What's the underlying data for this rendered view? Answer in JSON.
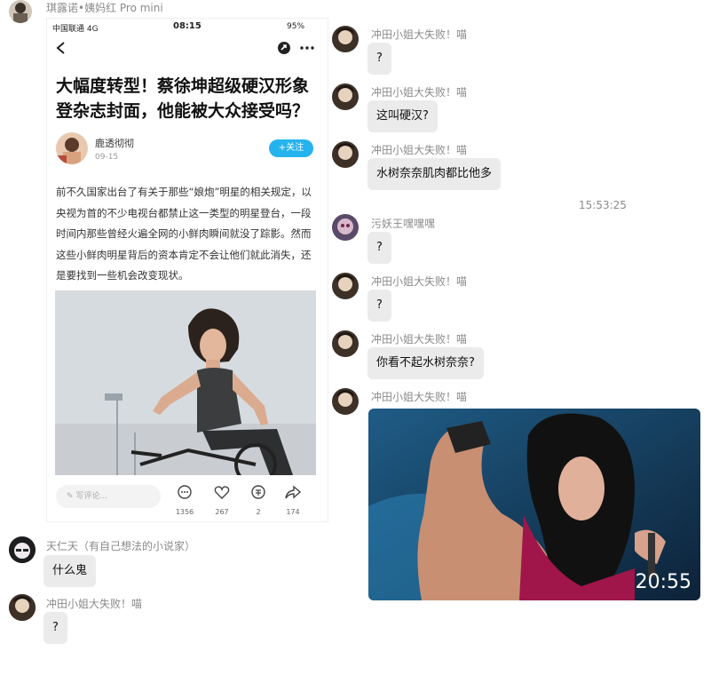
{
  "header": {
    "sender": "琪露诺•姨妈红 Pro mini"
  },
  "phone": {
    "carrier": "中国联通 4G",
    "time": "08:15",
    "battery": "95%",
    "headline": "大幅度转型！蔡徐坤超级硬汉形象登杂志封面，他能被大众接受吗？",
    "author": "鹿透彻彻",
    "date": "09-15",
    "follow_label": "+关注",
    "body": "前不久国家出台了有关于那些“娘炮”明星的相关规定，以央视为首的不少电视台都禁止这一类型的明星登台，一段时间内那些曾经火遍全网的小鲜肉瞬间就没了踪影。然而这些小鲜肉明星背后的资本肯定不会让他们就此消失，还是要找到一些机会改变现状。",
    "comment_placeholder": "写评论...",
    "stats": {
      "comments": "1356",
      "likes": "267",
      "shares_coin": "2",
      "forwards": "174"
    }
  },
  "left_messages": [
    {
      "sender": "天仁天（有自己想法的小说家）",
      "text": "什么鬼"
    },
    {
      "sender": "冲田小姐大失败！喵",
      "text": "?"
    }
  ],
  "right_messages": [
    {
      "sender": "冲田小姐大失败！喵",
      "text": "?"
    },
    {
      "sender": "冲田小姐大失败！喵",
      "text": "这叫硬汉?"
    },
    {
      "sender": "冲田小姐大失败！喵",
      "text": "水树奈奈肌肉都比他多"
    },
    {
      "sender": "污妖王嘿嘿嘿",
      "text": "?"
    },
    {
      "sender": "冲田小姐大失败！喵",
      "text": "?"
    },
    {
      "sender": "冲田小姐大失败！喵",
      "text": "你看不起水树奈奈?"
    },
    {
      "sender": "冲田小姐大失败！喵",
      "video_duration": "20:55"
    }
  ],
  "timestamp": "15:53:25"
}
